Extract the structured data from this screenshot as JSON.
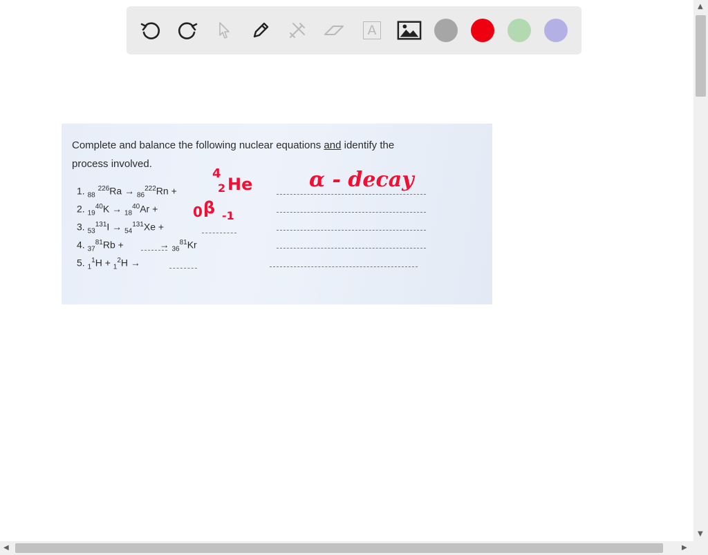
{
  "toolbar": {
    "tools": [
      "undo-icon",
      "redo-icon",
      "pointer-icon",
      "pen-icon",
      "tools-icon",
      "eraser-icon",
      "text-icon",
      "image-icon"
    ],
    "text_tool_glyph": "A",
    "colors": {
      "gray": "#a6a6a6",
      "red": "#ee0011",
      "green": "#b3d9b0",
      "purple": "#b3b0e6"
    }
  },
  "document": {
    "instruction_line1": "Complete and balance the following nuclear equations",
    "instruction_and": "and",
    "instruction_line1_end": "identify the",
    "instruction_line2": "process involved.",
    "equations": [
      {
        "num": "1.",
        "parts": [
          "88",
          "226",
          "Ra →",
          "86",
          "222",
          "Rn +"
        ]
      },
      {
        "num": "2.",
        "parts": [
          "19",
          "40",
          "K →",
          "18",
          "40",
          "Ar +"
        ]
      },
      {
        "num": "3.",
        "parts": [
          "53",
          "131",
          "I →",
          "54",
          "131",
          "Xe +"
        ]
      },
      {
        "num": "4.",
        "parts": [
          "37",
          "81",
          "Rb +",
          "→",
          "36",
          "81",
          "Kr"
        ]
      },
      {
        "num": "5.",
        "parts": [
          "1",
          "1",
          "H +",
          "1",
          "2",
          "H →"
        ]
      }
    ]
  },
  "handwriting": {
    "eq1_mass": "4",
    "eq1_atomic": "2",
    "eq1_symbol": "He",
    "eq1_answer": "α - decay",
    "eq2_mass": "0",
    "eq2_symbol": "β",
    "eq2_atomic": "-1"
  }
}
